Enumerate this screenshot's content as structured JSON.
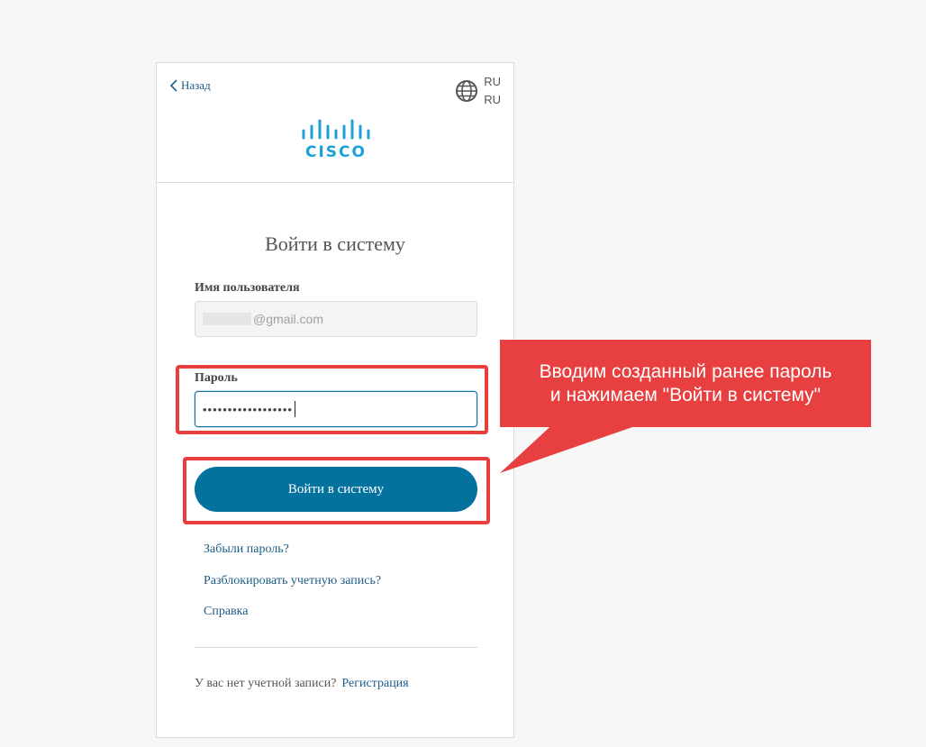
{
  "header": {
    "back_label": "Назад",
    "lang_primary": "RU",
    "lang_secondary": "RU",
    "logo_text": "CISCO"
  },
  "form": {
    "title": "Войти в систему",
    "username_label": "Имя пользователя",
    "username_value": "@gmail.com",
    "password_label": "Пароль",
    "password_value": "••••••••••••••••••",
    "submit_label": "Войти в систему"
  },
  "links": {
    "forgot": "Забыли пароль?",
    "unlock": "Разблокировать учетную запись?",
    "help": "Справка"
  },
  "footer": {
    "no_account": "У вас нет учетной записи?",
    "register": "Регистрация"
  },
  "annotation": {
    "line1": "Вводим созданный ранее пароль",
    "line2": "и нажимаем \"Войти в систему\""
  },
  "icons": {
    "back": "chevron-left-icon",
    "language": "globe-icon"
  },
  "colors": {
    "accent": "#04729f",
    "link": "#1b5d88",
    "logo": "#1ba0d7",
    "highlight": "#e83e3e"
  }
}
